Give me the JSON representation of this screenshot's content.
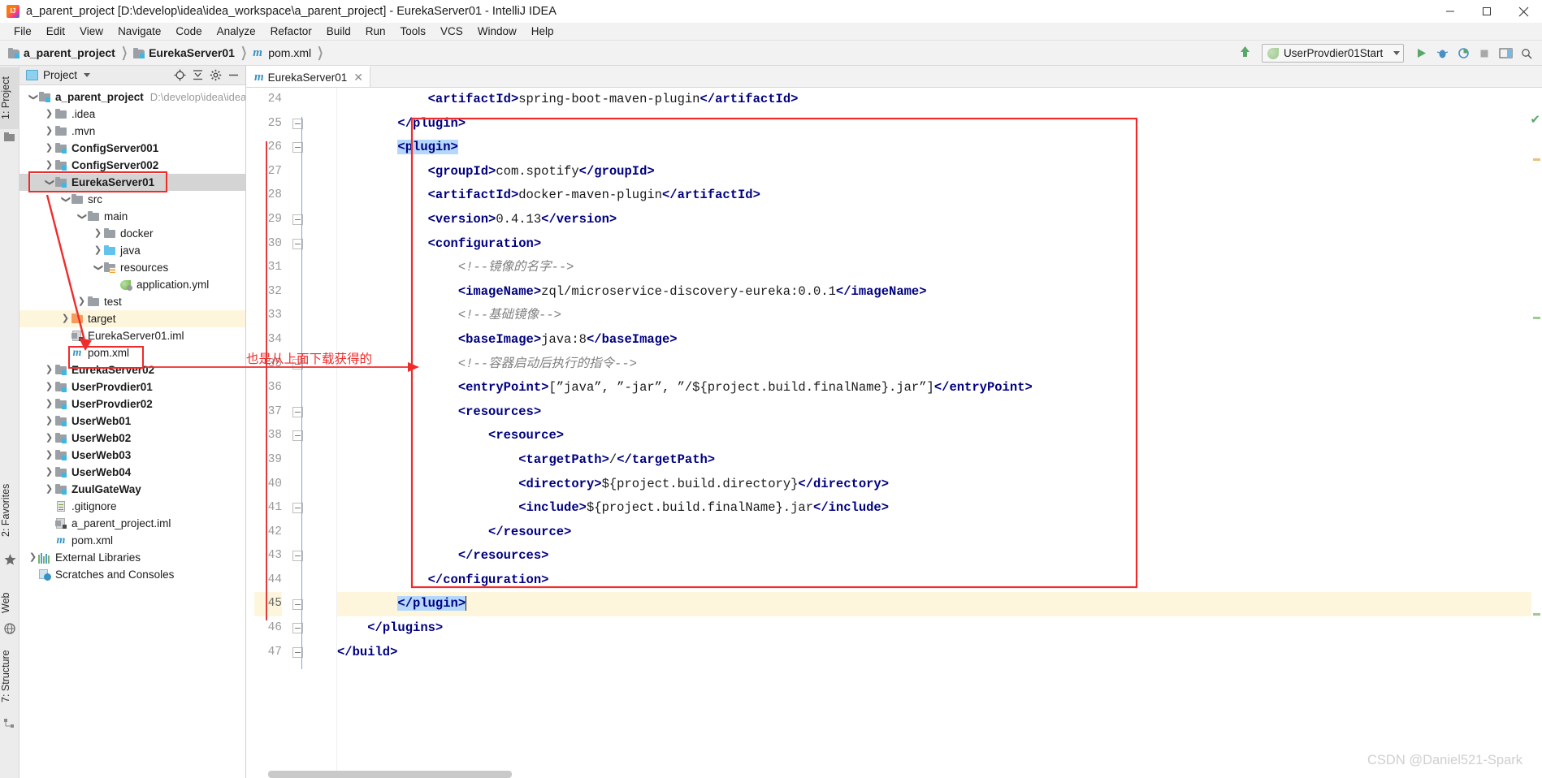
{
  "window": {
    "title": "a_parent_project [D:\\develop\\idea\\idea_workspace\\a_parent_project] - EurekaServer01 - IntelliJ IDEA",
    "logo_icon": "intellij-idea-logo",
    "minimize_icon": "minimize-icon",
    "maximize_icon": "maximize-icon",
    "close_icon": "close-icon"
  },
  "menubar": {
    "items": [
      {
        "label": "File"
      },
      {
        "label": "Edit"
      },
      {
        "label": "View"
      },
      {
        "label": "Navigate"
      },
      {
        "label": "Code"
      },
      {
        "label": "Analyze"
      },
      {
        "label": "Refactor"
      },
      {
        "label": "Build"
      },
      {
        "label": "Run"
      },
      {
        "label": "Tools"
      },
      {
        "label": "VCS"
      },
      {
        "label": "Window"
      },
      {
        "label": "Help"
      }
    ]
  },
  "breadcrumb": {
    "items": [
      {
        "label": "a_parent_project",
        "icon": "module-folder-icon"
      },
      {
        "label": "EurekaServer01",
        "icon": "module-folder-icon"
      },
      {
        "label": "pom.xml",
        "icon": "maven-file-icon"
      }
    ]
  },
  "toolbar": {
    "update_icon": "update-project-icon",
    "run_config": {
      "label": "UserProvdier01Start",
      "icon": "spring-leaf-icon",
      "caret": "chevron-down-icon"
    },
    "buttons": [
      {
        "name": "run-button",
        "icon": "play-icon",
        "color": "#59a869"
      },
      {
        "name": "debug-button",
        "icon": "bug-icon",
        "color": "#3c7ab8"
      },
      {
        "name": "run-with-coverage-button",
        "icon": "coverage-icon",
        "color": "#5b9bd5"
      },
      {
        "name": "stop-button",
        "icon": "stop-icon",
        "color": "#a0a0a0"
      },
      {
        "name": "layout-button",
        "icon": "layout-icon",
        "color": "#5b9bd5"
      }
    ]
  },
  "left_tool_strip": {
    "tabs": [
      {
        "label": "1: Project",
        "icon": "project-icon",
        "selected": true
      },
      {
        "label": "2: Favorites",
        "icon": "star-icon",
        "selected": false
      },
      {
        "label": "Web",
        "icon": "globe-icon",
        "selected": false
      },
      {
        "label": "7: Structure",
        "icon": "structure-icon",
        "selected": false
      }
    ]
  },
  "project_panel": {
    "title": "Project",
    "caret_icon": "chevron-down-icon",
    "actions": [
      {
        "name": "locate-icon",
        "glyph": "⊕"
      },
      {
        "name": "collapse-all-icon",
        "glyph": "↥"
      },
      {
        "name": "settings-gear-icon",
        "glyph": "⚙"
      },
      {
        "name": "hide-panel-icon",
        "glyph": "—"
      }
    ],
    "tree": [
      {
        "label": "a_parent_project",
        "path": "D:\\develop\\idea\\idea",
        "indent": 0,
        "twisty": "expanded",
        "icon": "module-folder-icon",
        "bold": true
      },
      {
        "label": ".idea",
        "indent": 1,
        "twisty": "collapsed",
        "icon": "folder-icon",
        "bold": false
      },
      {
        "label": ".mvn",
        "indent": 1,
        "twisty": "collapsed",
        "icon": "folder-icon",
        "bold": false
      },
      {
        "label": "ConfigServer001",
        "indent": 1,
        "twisty": "collapsed",
        "icon": "module-folder-icon",
        "bold": true
      },
      {
        "label": "ConfigServer002",
        "indent": 1,
        "twisty": "collapsed",
        "icon": "module-folder-icon",
        "bold": true
      },
      {
        "label": "EurekaServer01",
        "indent": 1,
        "twisty": "expanded",
        "icon": "module-folder-icon",
        "bold": true,
        "selected": true,
        "annotated": true
      },
      {
        "label": "src",
        "indent": 2,
        "twisty": "expanded",
        "icon": "folder-icon",
        "bold": false
      },
      {
        "label": "main",
        "indent": 3,
        "twisty": "expanded",
        "icon": "folder-icon",
        "bold": false
      },
      {
        "label": "docker",
        "indent": 4,
        "twisty": "collapsed",
        "icon": "folder-icon",
        "bold": false
      },
      {
        "label": "java",
        "indent": 4,
        "twisty": "collapsed",
        "icon": "source-folder-icon",
        "bold": false
      },
      {
        "label": "resources",
        "indent": 4,
        "twisty": "expanded",
        "icon": "resources-folder-icon",
        "bold": false
      },
      {
        "label": "application.yml",
        "indent": 5,
        "twisty": "none",
        "icon": "spring-yaml-icon",
        "bold": false
      },
      {
        "label": "test",
        "indent": 3,
        "twisty": "collapsed",
        "icon": "folder-icon",
        "bold": false
      },
      {
        "label": "target",
        "indent": 2,
        "twisty": "collapsed",
        "icon": "excluded-folder-icon",
        "bold": false,
        "highlighted": true
      },
      {
        "label": "EurekaServer01.iml",
        "indent": 2,
        "twisty": "none",
        "icon": "iml-file-icon",
        "bold": false
      },
      {
        "label": "pom.xml",
        "indent": 2,
        "twisty": "none",
        "icon": "maven-file-icon",
        "bold": false,
        "annotated": true
      },
      {
        "label": "EurekaServer02",
        "indent": 1,
        "twisty": "collapsed",
        "icon": "module-folder-icon",
        "bold": true
      },
      {
        "label": "UserProvdier01",
        "indent": 1,
        "twisty": "collapsed",
        "icon": "module-folder-icon",
        "bold": true
      },
      {
        "label": "UserProvdier02",
        "indent": 1,
        "twisty": "collapsed",
        "icon": "module-folder-icon",
        "bold": true
      },
      {
        "label": "UserWeb01",
        "indent": 1,
        "twisty": "collapsed",
        "icon": "module-folder-icon",
        "bold": true
      },
      {
        "label": "UserWeb02",
        "indent": 1,
        "twisty": "collapsed",
        "icon": "module-folder-icon",
        "bold": true
      },
      {
        "label": "UserWeb03",
        "indent": 1,
        "twisty": "collapsed",
        "icon": "module-folder-icon",
        "bold": true
      },
      {
        "label": "UserWeb04",
        "indent": 1,
        "twisty": "collapsed",
        "icon": "module-folder-icon",
        "bold": true
      },
      {
        "label": "ZuulGateWay",
        "indent": 1,
        "twisty": "collapsed",
        "icon": "module-folder-icon",
        "bold": true
      },
      {
        "label": ".gitignore",
        "indent": 1,
        "twisty": "none",
        "icon": "gitignore-file-icon",
        "bold": false
      },
      {
        "label": "a_parent_project.iml",
        "indent": 1,
        "twisty": "none",
        "icon": "iml-file-icon",
        "bold": false
      },
      {
        "label": "pom.xml",
        "indent": 1,
        "twisty": "none",
        "icon": "maven-file-icon",
        "bold": false
      },
      {
        "label": "External Libraries",
        "indent": 0,
        "twisty": "collapsed",
        "icon": "libraries-icon",
        "bold": false
      },
      {
        "label": "Scratches and Consoles",
        "indent": 0,
        "twisty": "none",
        "icon": "scratches-icon",
        "bold": false
      }
    ]
  },
  "editor": {
    "tab": {
      "label": "EurekaServer01",
      "icon": "maven-file-icon",
      "close_icon": "close-icon"
    },
    "current_line": 45,
    "lines": [
      {
        "num": 24,
        "indent": 7,
        "text": "<artifactId>spring-boot-maven-plugin</artifactId>",
        "clipped": true
      },
      {
        "num": 25,
        "indent": 6,
        "text": "</plugin>"
      },
      {
        "num": 26,
        "indent": 6,
        "text": "<plugin>",
        "selected": true
      },
      {
        "num": 27,
        "indent": 7,
        "text": "<groupId>com.spotify</groupId>"
      },
      {
        "num": 28,
        "indent": 7,
        "text": "<artifactId>docker-maven-plugin</artifactId>"
      },
      {
        "num": 29,
        "indent": 7,
        "text": "<version>0.4.13</version>"
      },
      {
        "num": 30,
        "indent": 7,
        "text": "<configuration>"
      },
      {
        "num": 31,
        "indent": 8,
        "text": "<!--镜像的名字-->",
        "comment": true
      },
      {
        "num": 32,
        "indent": 8,
        "text": "<imageName>zql/microservice-discovery-eureka:0.0.1</imageName>"
      },
      {
        "num": 33,
        "indent": 8,
        "text": "<!--基础镜像-->",
        "comment": true
      },
      {
        "num": 34,
        "indent": 8,
        "text": "<baseImage>java:8</baseImage>"
      },
      {
        "num": 35,
        "indent": 8,
        "text": "<!--容器启动后执行的指令-->",
        "comment": true
      },
      {
        "num": 36,
        "indent": 8,
        "text": "<entryPoint>[”java”, ”-jar”, ”/${project.build.finalName}.jar”]</entryPoint>"
      },
      {
        "num": 37,
        "indent": 8,
        "text": "<resources>"
      },
      {
        "num": 38,
        "indent": 9,
        "text": "<resource>"
      },
      {
        "num": 39,
        "indent": 10,
        "text": "<targetPath>/</targetPath>"
      },
      {
        "num": 40,
        "indent": 10,
        "text": "<directory>${project.build.directory}</directory>"
      },
      {
        "num": 41,
        "indent": 10,
        "text": "<include>${project.build.finalName}.jar</include>"
      },
      {
        "num": 42,
        "indent": 9,
        "text": "</resource>"
      },
      {
        "num": 43,
        "indent": 8,
        "text": "</resources>"
      },
      {
        "num": 44,
        "indent": 7,
        "text": "</configuration>"
      },
      {
        "num": 45,
        "indent": 6,
        "text": "</plugin>",
        "selected": true,
        "current": true
      },
      {
        "num": 46,
        "indent": 5,
        "text": "</plugins>"
      },
      {
        "num": 47,
        "indent": 4,
        "text": "</build>"
      }
    ]
  },
  "annotations": {
    "note_text": "也是从上面下载获得的",
    "accent_color": "#f02b2b"
  },
  "watermark": {
    "text": "CSDN @Daniel521-Spark"
  }
}
